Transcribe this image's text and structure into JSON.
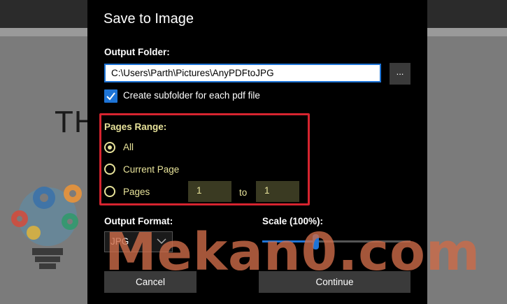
{
  "background": {
    "doc_text": "TH"
  },
  "dialog": {
    "title": "Save to Image",
    "output_folder": {
      "label": "Output Folder:",
      "value": "C:\\Users\\Parth\\Pictures\\AnyPDFtoJPG",
      "browse_label": "..."
    },
    "subfolder_checkbox": {
      "label": "Create subfolder for each pdf file",
      "checked": true
    },
    "pages_range": {
      "label": "Pages Range:",
      "options": [
        {
          "label": "All",
          "selected": true
        },
        {
          "label": "Current Page",
          "selected": false
        },
        {
          "label": "Pages",
          "selected": false
        }
      ],
      "from": "1",
      "to_label": "to",
      "to": "1"
    },
    "output_format": {
      "label": "Output Format:",
      "selected": "JPG"
    },
    "scale": {
      "label": "Scale (100%):",
      "fraction": 0.36
    },
    "buttons": {
      "cancel": "Cancel",
      "continue": "Continue"
    }
  },
  "watermark": "Mekan0.com",
  "colors": {
    "accent": "#1e74d6",
    "highlight_border": "#d6242f",
    "disabled_text": "#e8e39a",
    "watermark": "#cd6c48"
  }
}
